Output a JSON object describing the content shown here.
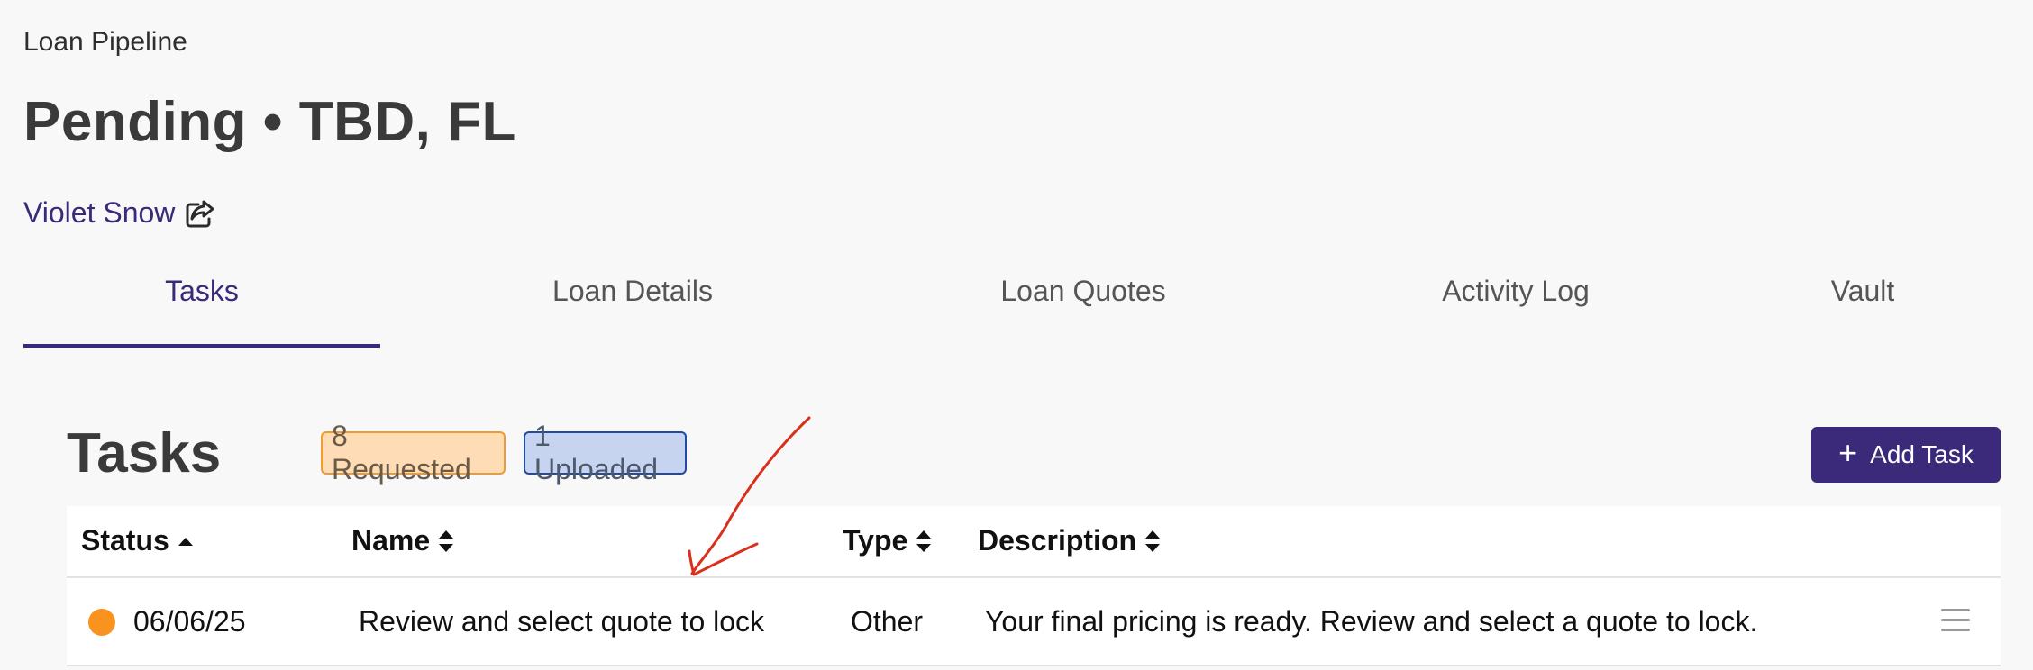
{
  "breadcrumb": "Loan Pipeline",
  "page_title": "Pending • TBD, FL",
  "contact": {
    "name": "Violet Snow",
    "icon": "external-share-icon"
  },
  "tabs": [
    {
      "label": "Tasks",
      "active": true
    },
    {
      "label": "Loan Details",
      "active": false
    },
    {
      "label": "Loan Quotes",
      "active": false
    },
    {
      "label": "Activity Log",
      "active": false
    },
    {
      "label": "Vault",
      "active": false
    }
  ],
  "tasks_section": {
    "title": "Tasks",
    "badges": {
      "requested": "8 Requested",
      "uploaded": "1 Uploaded"
    },
    "add_button": "Add Task",
    "columns": {
      "status": "Status",
      "name": "Name",
      "type": "Type",
      "description": "Description"
    },
    "rows": [
      {
        "status_color": "#f7931e",
        "date": "06/06/25",
        "name": "Review and select quote to lock",
        "type": "Other",
        "description": "Your final pricing is ready. Review and select a quote to lock."
      }
    ]
  },
  "colors": {
    "accent": "#3b2a7a",
    "annotation": "#d9301c",
    "requested_badge": "#f39a2d",
    "uploaded_badge": "#1f4ba5"
  }
}
